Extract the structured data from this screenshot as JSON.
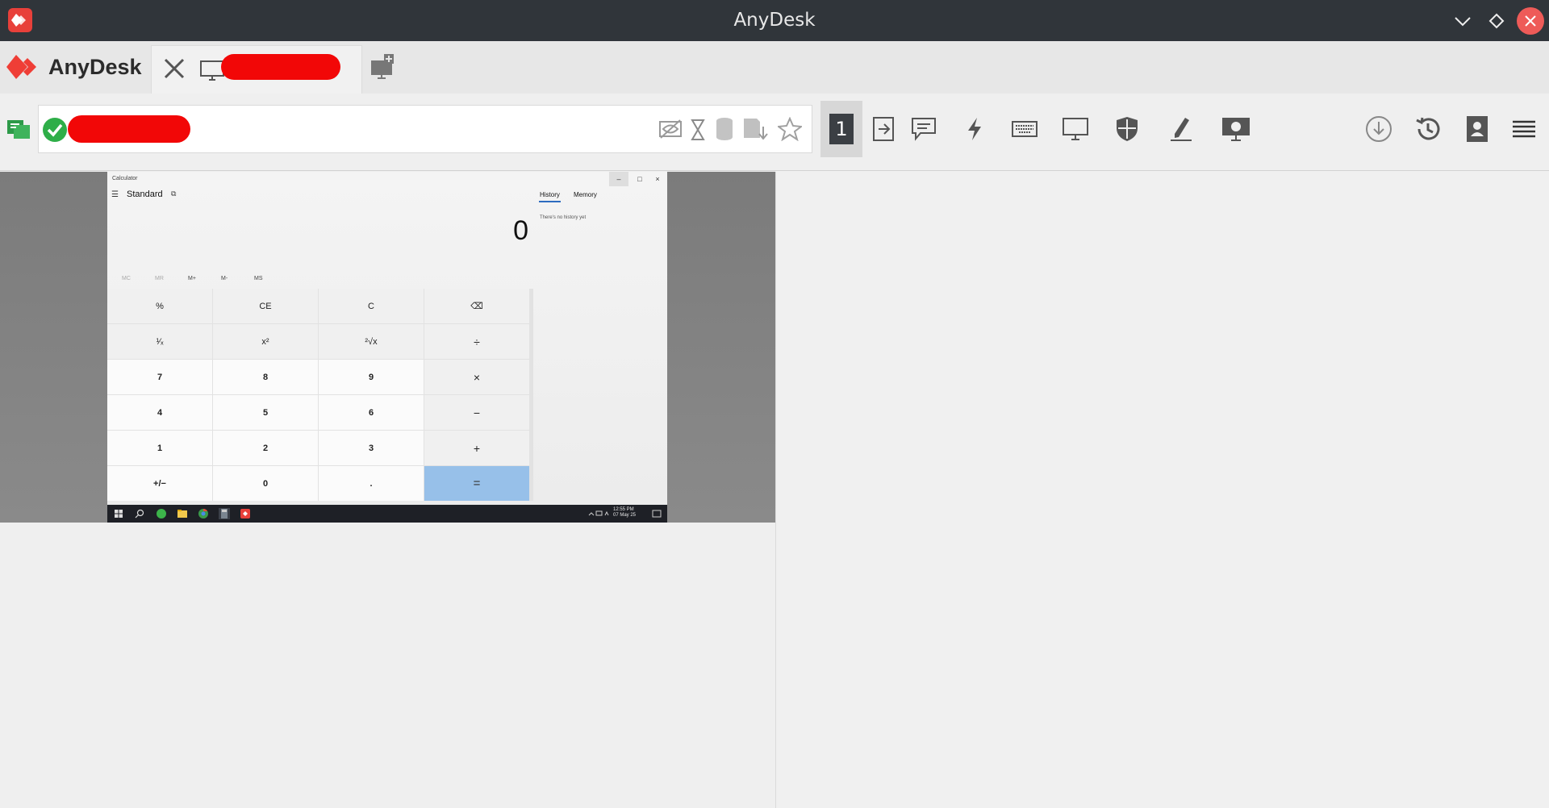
{
  "window": {
    "title": "AnyDesk"
  },
  "brand": {
    "name": "AnyDesk"
  },
  "icons": {
    "app": "anydesk-logo-icon",
    "minimize": "chevron-down-icon",
    "maximize": "diamond-icon",
    "close": "close-icon",
    "tab_close": "close-icon",
    "tab_monitor": "monitor-icon",
    "new_tab": "new-session-icon",
    "toolbar": [
      "connection-status-icon",
      "privacy-hidden-icon",
      "hourglass-icon",
      "database-icon",
      "file-transfer-icon",
      "favorite-star-icon",
      "display-1-icon",
      "switch-sides-icon",
      "chat-icon",
      "actions-icon",
      "keyboard-icon",
      "display-icon",
      "permissions-icon",
      "whiteboard-icon",
      "recording-icon",
      "download-icon",
      "history-icon",
      "address-book-icon",
      "menu-icon"
    ]
  },
  "colors": {
    "titlebar": "#30353a",
    "accent": "#e8403a",
    "ok": "#2eae48",
    "equals": "#97c0e9"
  },
  "toolbar": {
    "display_number": "1"
  },
  "calculator": {
    "title": "Calculator",
    "mode": "Standard",
    "display": "0",
    "memory_buttons": [
      "MC",
      "MR",
      "M+",
      "M-",
      "MS"
    ],
    "history_tab": "History",
    "memory_tab": "Memory",
    "history_empty": "There's no history yet",
    "keys": [
      "%",
      "CE",
      "C",
      "⌫",
      "¹⁄ₓ",
      "x²",
      "²√x",
      "÷",
      "7",
      "8",
      "9",
      "×",
      "4",
      "5",
      "6",
      "−",
      "1",
      "2",
      "3",
      "+",
      "+/−",
      "0",
      ".",
      "="
    ]
  },
  "taskbar": {
    "time": "12:55 PM",
    "date": "07 May 25"
  }
}
